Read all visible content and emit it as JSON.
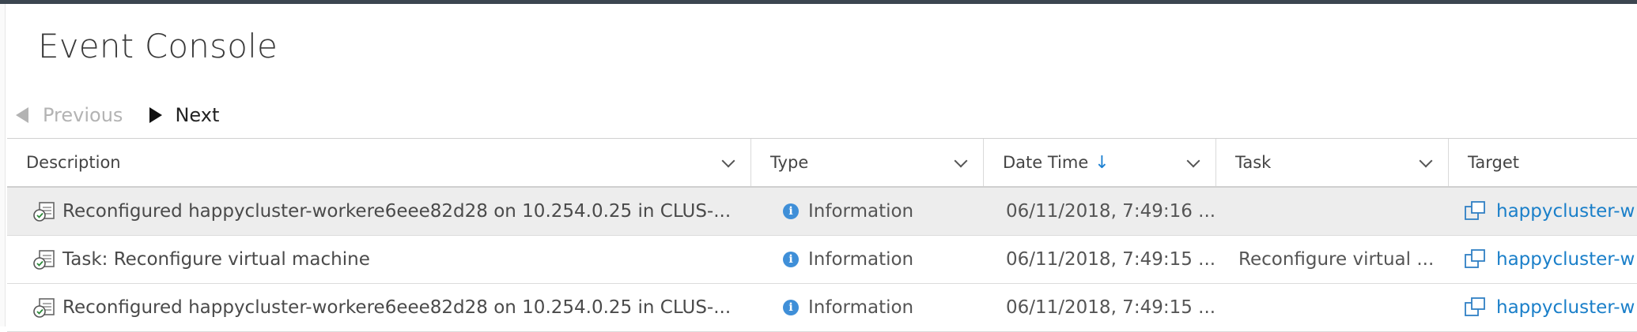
{
  "page": {
    "title": "Event Console"
  },
  "pager": {
    "previous_label": "Previous",
    "next_label": "Next"
  },
  "table": {
    "columns": {
      "description": "Description",
      "type": "Type",
      "date_time": "Date Time",
      "task": "Task",
      "target": "Target"
    },
    "sort_indicator": "↓",
    "rows": [
      {
        "description": "Reconfigured happycluster-workere6eee82d28 on 10.254.0.25 in CLUS-...",
        "type": "Information",
        "date_time": "06/11/2018, 7:49:16 ...",
        "task": "",
        "target": "happycluster-w"
      },
      {
        "description": "Task: Reconfigure virtual machine",
        "type": "Information",
        "date_time": "06/11/2018, 7:49:15 ...",
        "task": "Reconfigure virtual ...",
        "target": "happycluster-w"
      },
      {
        "description": "Reconfigured happycluster-workere6eee82d28 on 10.254.0.25 in CLUS-...",
        "type": "Information",
        "date_time": "06/11/2018, 7:49:15 ...",
        "task": "",
        "target": "happycluster-w"
      }
    ]
  },
  "colors": {
    "accent": "#1a7fc9",
    "topbar": "#3c4650",
    "selected_row": "#ededed"
  }
}
